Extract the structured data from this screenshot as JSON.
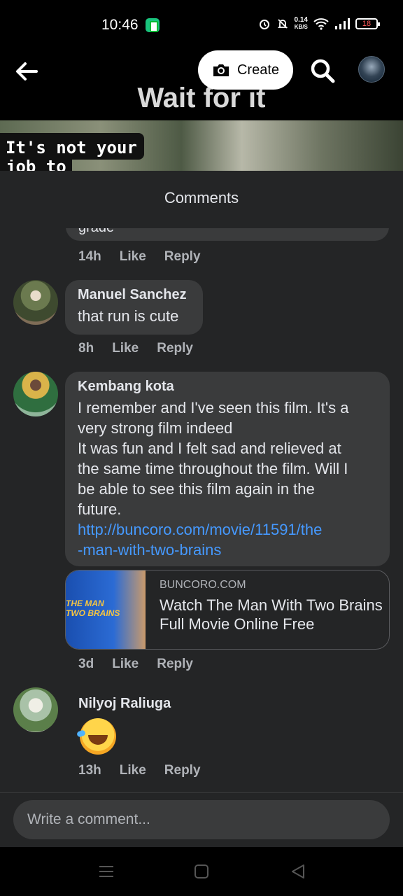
{
  "status": {
    "time": "10:46",
    "speed_top": "0.14",
    "speed_bottom": "KB/S",
    "battery": "18"
  },
  "header": {
    "create_label": "Create",
    "video_overlay_text": "Wait for it",
    "caption_line1": "It's not your",
    "caption_line2": "job to"
  },
  "comments_sheet": {
    "title": "Comments",
    "partial_comment": {
      "text": "grade",
      "time": "14h",
      "like": "Like",
      "reply": "Reply"
    },
    "comments": [
      {
        "author": "Manuel Sanchez",
        "text": "that run is cute",
        "time": "8h",
        "like": "Like",
        "reply": "Reply"
      },
      {
        "author": "Kembang kota",
        "text_lines": [
          "I remember and I've seen this film. It's a",
          "very strong film indeed",
          "It was fun and I felt sad and relieved at",
          "the same time throughout the film. Will I",
          "be able to see this film again in the",
          "future."
        ],
        "link_lines": [
          "http://buncoro.com/movie/11591/the",
          "-man-with-two-brains"
        ],
        "preview": {
          "domain": "BUNCORO.COM",
          "title": "Watch The Man With Two Brains Full Movie Online Free",
          "thumb_text_1": "THE MAN",
          "thumb_text_2": "TWO BRAINS"
        },
        "time": "3d",
        "like": "Like",
        "reply": "Reply"
      },
      {
        "author": "Nilyoj Raliuga",
        "emoji": "rolling-on-floor-laughing",
        "time": "13h",
        "like": "Like",
        "reply": "Reply"
      }
    ],
    "composer_placeholder": "Write a comment..."
  }
}
